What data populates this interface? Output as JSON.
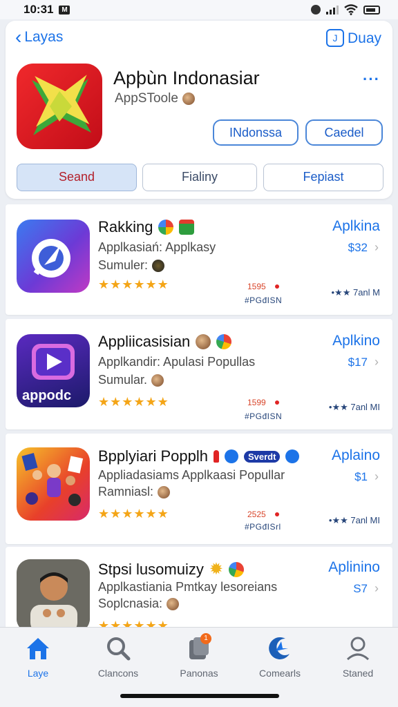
{
  "status_bar": {
    "time": "10:31",
    "box_label": "M"
  },
  "header": {
    "back_label": "Layas",
    "share_label": "J",
    "right_label": "Duay",
    "more_label": "···",
    "app_title": "Apþùn Indonasiar",
    "app_subtitle": "AppSToole",
    "pill_1": "INdonssa",
    "pill_2": "Caedel",
    "segments": [
      "Seand",
      "Fialiny",
      "Fepiast"
    ]
  },
  "apps": [
    {
      "title": "Rakking",
      "line1": "Applkasiań: Applkasy",
      "line2": "Sumuler:",
      "stars": "★★★★★★",
      "count": "1595",
      "code": "#PGđISN",
      "action": "Aplkina",
      "price": "$32",
      "meta": "•★★ 7anl M"
    },
    {
      "title": "Appliicasisian",
      "line1": "Applkandir: Apulasi Popullas",
      "line2": "Sumular.",
      "stars": "★★★★★★",
      "count": "1599",
      "code": "#PGđISN",
      "action": "Aplkino",
      "price": "$17",
      "meta": "•★★ 7anl MI",
      "icon_text": "appodc"
    },
    {
      "title": "Bpplyiari Popplh",
      "verified": "Sverdt",
      "line1": "Appliadasiams Applkaasi Popullar",
      "line2": "Ramniasl:",
      "stars": "★★★★★★",
      "count": "2525",
      "code": "#PGđISrl",
      "action": "Aplaino",
      "price": "$1",
      "meta": "•★★ 7anl MI"
    },
    {
      "title": "Stpsi lusomuizy",
      "line1": "Applkastiania Pmtkay lesoreians",
      "line2": "Soplcnasia:",
      "stars": "★★★★★★",
      "action": "Aplinino",
      "price": "S7"
    }
  ],
  "tabs": [
    {
      "label": "Laye",
      "icon": "home-icon"
    },
    {
      "label": "Clancons",
      "icon": "search-icon"
    },
    {
      "label": "Panonas",
      "icon": "apps-icon",
      "badge": "1"
    },
    {
      "label": "Comearls",
      "icon": "arcade-icon"
    },
    {
      "label": "Staned",
      "icon": "profile-icon"
    }
  ],
  "colors": {
    "accent": "#1c73e8",
    "star": "#f4a517",
    "hero_red": "#e0201f"
  }
}
